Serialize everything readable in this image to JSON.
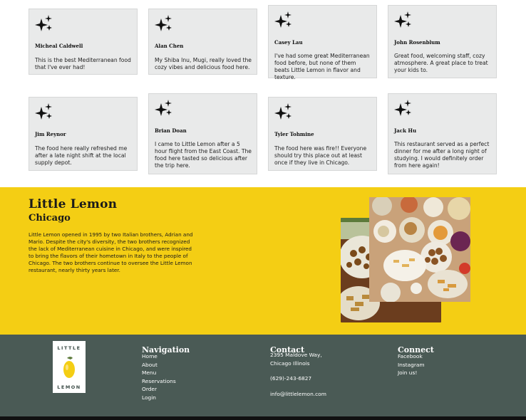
{
  "testimonials": [
    {
      "name": "Micheal Caldwell",
      "review": "This is the best Mediterranean food that I've ever had!"
    },
    {
      "name": "Alan Chen",
      "review": "My Shiba Inu, Mugi, really loved the cozy vibes and delicious food here."
    },
    {
      "name": "Casey Lau",
      "review": "I've had some great Mediterranean food before, but none of them beats Little Lemon in flavor and texture."
    },
    {
      "name": "John Rosenblum",
      "review": "Great food, welcoming staff, cozy atmosphere. A great place to treat your kids to."
    },
    {
      "name": "Jim Reynor",
      "review": "The food here really refreshed me after a late night shift at the local supply depot."
    },
    {
      "name": "Brian Doan",
      "review": "I came to Little Lemon after a 5 hour flight from the East Coast. The food here tasted so delicious after the trip here."
    },
    {
      "name": "Tyler Tohmine",
      "review": "The food here was fire!! Everyone should try this place out at least once if they live in Chicago."
    },
    {
      "name": "Jack Hu",
      "review": "This restaurant served as a perfect dinner for me after a long night of studying. I would definitely order from here again!"
    }
  ],
  "about": {
    "title": "Little Lemon",
    "subtitle": "Chicago",
    "text": "Little Lemon opened in 1995 by two Italian brothers, Adrian and Mario. Despite the city's diversity, the two brothers recognized the lack of Mediterranean cuisine in Chicago, and were inspired to bring the flavors of their hometown in Italy to the people of Chicago. The two brothers continue to oversee the Little Lemon restaurant, nearly thirty years later."
  },
  "footer": {
    "logo": {
      "top": "LITTLE",
      "bottom": "LEMON"
    },
    "navigation": {
      "heading": "Navigation",
      "links": [
        "Home",
        "About",
        "Menu",
        "Reservations",
        "Order",
        "Login"
      ]
    },
    "contact": {
      "heading": "Contact",
      "address_line1": "2395 Maldove Way,",
      "address_line2": "Chicago Illinois",
      "phone": "(629)-243-6827",
      "email": "info@littlelemon.com"
    },
    "connect": {
      "heading": "Connect",
      "links": [
        "Facebook",
        "Instagram",
        "Join us!"
      ]
    }
  },
  "icons": {
    "testimonial": "sparkle-icon"
  },
  "colors": {
    "brand_yellow": "#f4ce14",
    "brand_green": "#4a5a55",
    "card_bg": "#e9eaea"
  }
}
